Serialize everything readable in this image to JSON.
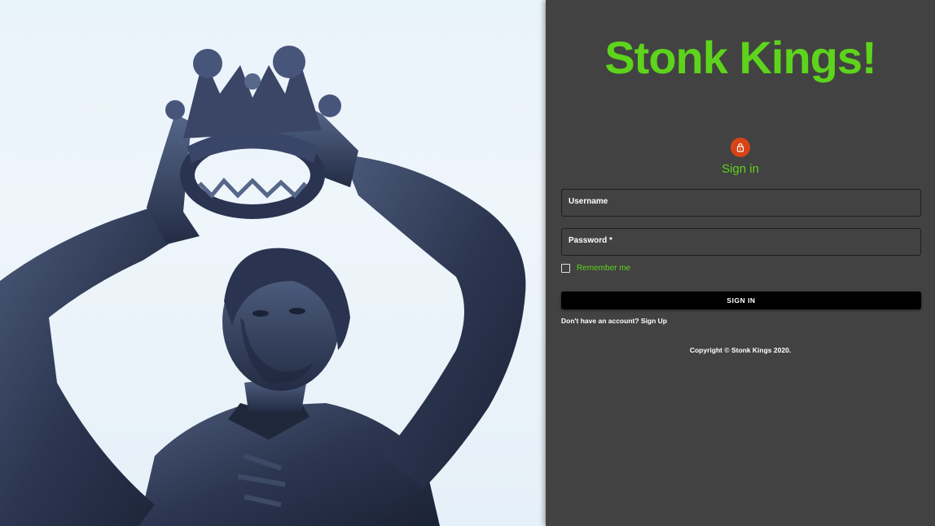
{
  "brand": {
    "title": "Stonk Kings!"
  },
  "hero": {
    "icon": "crowned-statue-photo"
  },
  "form": {
    "icon": "lock-icon",
    "heading": "Sign in",
    "username_label": "Username",
    "password_label": "Password *",
    "remember_label": "Remember me",
    "remember_checked": false,
    "submit_label": "SIGN IN",
    "signup_text": "Don't have an account? Sign Up"
  },
  "footer": {
    "copyright": "Copyright © Stonk Kings 2020."
  },
  "colors": {
    "accent": "#5dd41b",
    "panel_bg": "#424242",
    "avatar_bg": "#d84315",
    "button_bg": "#000000"
  }
}
